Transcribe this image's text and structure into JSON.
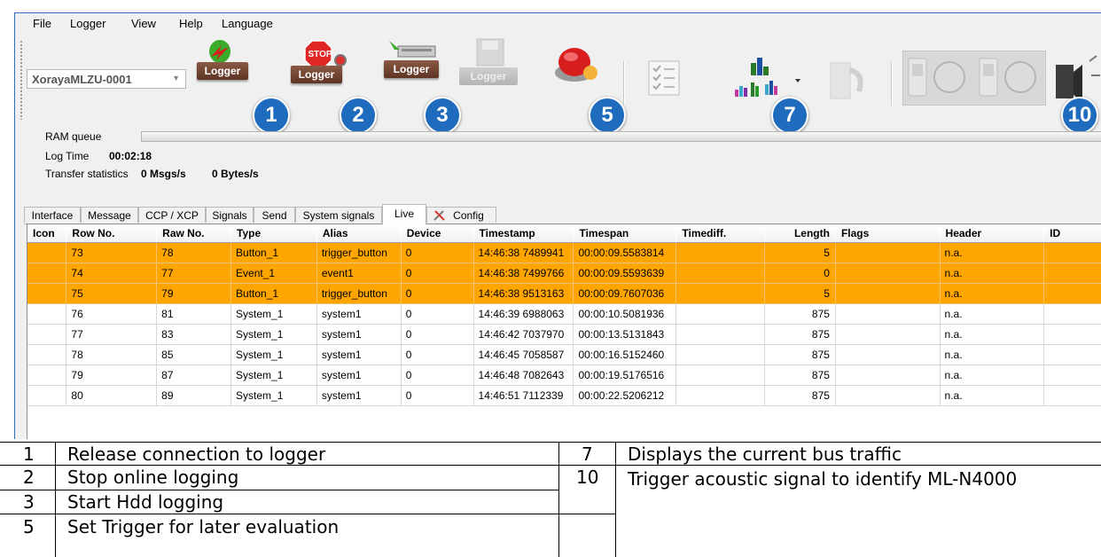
{
  "menu": [
    "File",
    "Logger",
    "View",
    "Help",
    "Language"
  ],
  "logger_select": {
    "value": "XorayaMLZU-0001"
  },
  "toolbar": {
    "release_label": "Logger",
    "stop_label": "Logger",
    "stop_sign_text": "STOP",
    "hdd_label": "Logger",
    "disabled_label": "Logger",
    "badges": [
      "1",
      "2",
      "3",
      "5",
      "7",
      "10"
    ],
    "icons": [
      "disconnect-logger-icon",
      "stop-logger-icon",
      "hdd-logger-icon",
      "save-logger-icon",
      "trigger-icon",
      "checklist-icon",
      "bus-traffic-chart-icon",
      "restart-icon",
      "switch-icon",
      "speaker-icon"
    ]
  },
  "info": {
    "ram_queue_label": "RAM queue",
    "log_time_label": "Log Time",
    "log_time_value": "00:02:18",
    "transfer_label": "Transfer statistics",
    "msgs_value": "0 Msgs/s",
    "bytes_value": "0 Bytes/s"
  },
  "tabs": [
    "Interface",
    "Message",
    "CCP / XCP",
    "Signals",
    "Send",
    "System signals",
    "Live",
    "Config"
  ],
  "active_tab": "Live",
  "table": {
    "columns": [
      "Icon",
      "Row No.",
      "Raw No.",
      "Type",
      "Alias",
      "Device",
      "Timestamp",
      "Timespan",
      "Timediff.",
      "Length",
      "Flags",
      "Header",
      "ID"
    ],
    "rows": [
      {
        "highlight": true,
        "cells": [
          "",
          "73",
          "78",
          "Button_1",
          "trigger_button",
          "0",
          "14:46:38 7489941",
          "00:00:09.5583814",
          "",
          "5",
          "",
          "n.a.",
          ""
        ]
      },
      {
        "highlight": true,
        "cells": [
          "",
          "74",
          "77",
          "Event_1",
          "event1",
          "0",
          "14:46:38 7499766",
          "00:00:09.5593639",
          "",
          "0",
          "",
          "n.a.",
          ""
        ]
      },
      {
        "highlight": true,
        "cells": [
          "",
          "75",
          "79",
          "Button_1",
          "trigger_button",
          "0",
          "14:46:38 9513163",
          "00:00:09.7607036",
          "",
          "5",
          "",
          "n.a.",
          ""
        ]
      },
      {
        "highlight": false,
        "cells": [
          "",
          "76",
          "81",
          "System_1",
          "system1",
          "0",
          "14:46:39 6988063",
          "00:00:10.5081936",
          "",
          "875",
          "",
          "n.a.",
          ""
        ]
      },
      {
        "highlight": false,
        "cells": [
          "",
          "77",
          "83",
          "System_1",
          "system1",
          "0",
          "14:46:42 7037970",
          "00:00:13.5131843",
          "",
          "875",
          "",
          "n.a.",
          ""
        ]
      },
      {
        "highlight": false,
        "cells": [
          "",
          "78",
          "85",
          "System_1",
          "system1",
          "0",
          "14:46:45 7058587",
          "00:00:16.5152460",
          "",
          "875",
          "",
          "n.a.",
          ""
        ]
      },
      {
        "highlight": false,
        "cells": [
          "",
          "79",
          "87",
          "System_1",
          "system1",
          "0",
          "14:46:48 7082643",
          "00:00:19.5176516",
          "",
          "875",
          "",
          "n.a.",
          ""
        ]
      },
      {
        "highlight": false,
        "cells": [
          "",
          "80",
          "89",
          "System_1",
          "system1",
          "0",
          "14:46:51 7112339",
          "00:00:22.5206212",
          "",
          "875",
          "",
          "n.a.",
          ""
        ]
      }
    ]
  },
  "legend": {
    "left": [
      {
        "num": "1",
        "text": "Release connection to logger"
      },
      {
        "num": "2",
        "text": "Stop online logging"
      },
      {
        "num": "3",
        "text": "Start Hdd logging"
      },
      {
        "num": "5",
        "text": "Set Trigger for later evaluation"
      }
    ],
    "right": [
      {
        "num": "7",
        "text": "Displays the current bus traffic"
      },
      {
        "num": "10",
        "text": "Trigger acoustic signal to identify ML-N4000"
      }
    ]
  },
  "colors": {
    "highlight_row": "#ffa500",
    "badge": "#1f6bbd",
    "logger_label": "#6e4030"
  }
}
